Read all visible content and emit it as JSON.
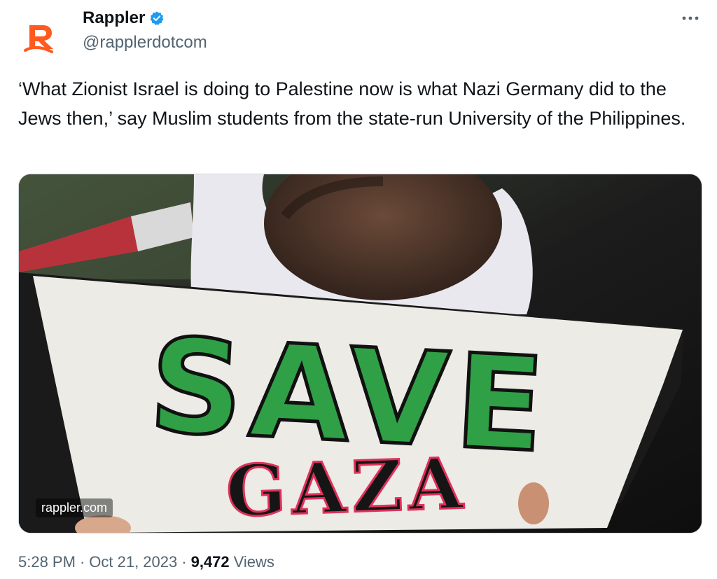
{
  "author": {
    "display_name": "Rappler",
    "handle": "@rapplerdotcom",
    "avatar_icon": "rappler-logo-icon",
    "verified_icon": "verified-badge-icon",
    "brand_color": "#ff5a1f",
    "verified_color": "#1d9bf0"
  },
  "more_icon": "more-options-icon",
  "tweet": {
    "text": "‘What Zionist Israel is doing to Palestine now is what Nazi Germany did to the Jews then,’ say Muslim students from the state-run University of the Philippines."
  },
  "media": {
    "sign_line1": "SAVE",
    "sign_line2": "GAZA",
    "watermark": "rappler.com"
  },
  "meta": {
    "time": "5:28 PM",
    "separator1": "·",
    "date": "Oct 21, 2023",
    "separator2": "·",
    "views_count": "9,472",
    "views_label": "Views"
  }
}
